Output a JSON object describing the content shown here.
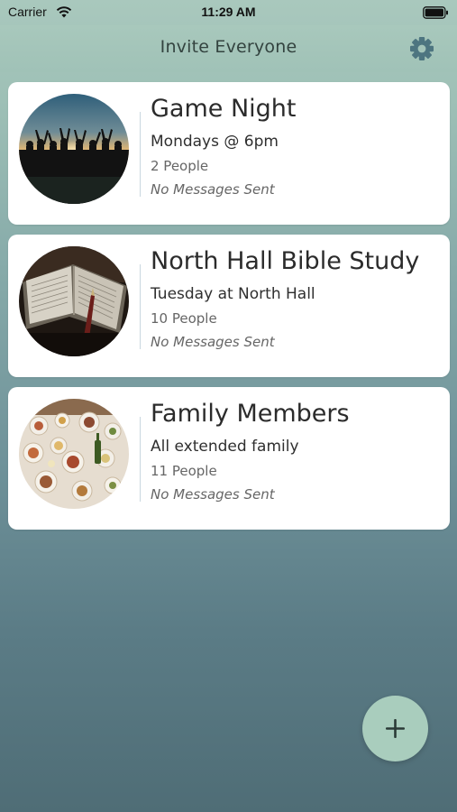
{
  "status_bar": {
    "carrier": "Carrier",
    "time": "11:29 AM"
  },
  "nav": {
    "title": "Invite Everyone"
  },
  "groups": [
    {
      "title": "Game Night",
      "subtitle": "Mondays @ 6pm",
      "count": "2 People",
      "messages": "No Messages Sent",
      "image": "silhouettes-at-sunset-photo"
    },
    {
      "title": "North Hall Bible Study",
      "subtitle": "Tuesday at North Hall",
      "count": "10 People",
      "messages": "No Messages Sent",
      "image": "open-bible-photo"
    },
    {
      "title": "Family Members",
      "subtitle": "All extended family",
      "count": "11 People",
      "messages": "No Messages Sent",
      "image": "dinner-table-photo"
    }
  ],
  "icons": {
    "settings": "gear-icon",
    "add": "plus-icon",
    "wifi": "wifi-icon",
    "battery": "battery-icon"
  },
  "colors": {
    "accent": "#4d7580",
    "fab": "#a9cdbd",
    "nav": "#a4c5b9"
  }
}
